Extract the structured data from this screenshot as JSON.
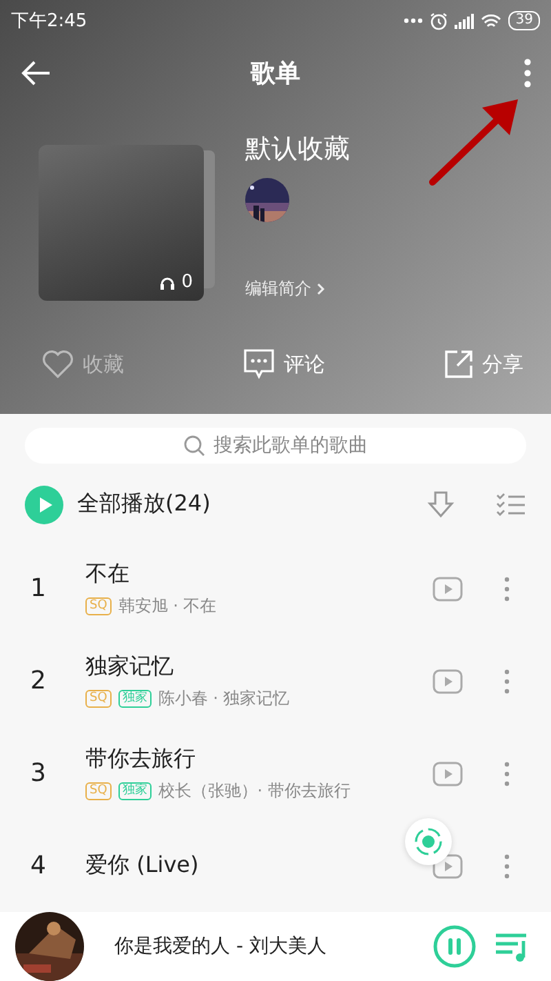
{
  "status_bar": {
    "time": "下午2:45",
    "battery": "39"
  },
  "nav": {
    "title": "歌单"
  },
  "playlist": {
    "name": "默认收藏",
    "play_count": "0",
    "edit_link": "编辑简介"
  },
  "actions": [
    {
      "kind": "heart",
      "label": "收藏",
      "disabled": true
    },
    {
      "kind": "comment",
      "label": "评论",
      "disabled": false
    },
    {
      "kind": "share",
      "label": "分享",
      "disabled": false
    }
  ],
  "search": {
    "placeholder": "搜索此歌单的歌曲"
  },
  "play_all": {
    "label": "全部播放(24)"
  },
  "songs": [
    {
      "index": "1",
      "title": "不在",
      "tags": [
        {
          "label": "SQ",
          "color": "#e8b04a"
        }
      ],
      "subtitle": "韩安旭 · 不在"
    },
    {
      "index": "2",
      "title": "独家记忆",
      "tags": [
        {
          "label": "SQ",
          "color": "#e8b04a"
        },
        {
          "label": "独家",
          "color": "#2ecf98"
        }
      ],
      "subtitle": "陈小春 · 独家记忆"
    },
    {
      "index": "3",
      "title": "带你去旅行",
      "tags": [
        {
          "label": "SQ",
          "color": "#e8b04a"
        },
        {
          "label": "独家",
          "color": "#2ecf98"
        }
      ],
      "subtitle": "校长（张驰）· 带你去旅行"
    },
    {
      "index": "4",
      "title": "爱你 (Live)"
    }
  ],
  "player": {
    "now_playing": "你是我爱的人 - 刘大美人",
    "playing": true
  }
}
